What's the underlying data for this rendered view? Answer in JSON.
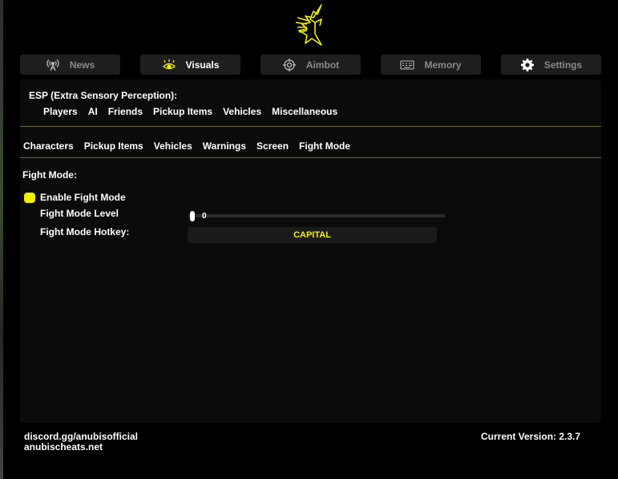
{
  "app": {
    "accent": "#f3f000"
  },
  "tabs": [
    {
      "label": "News",
      "icon": "antenna-icon"
    },
    {
      "label": "Visuals",
      "icon": "eye-icon"
    },
    {
      "label": "Aimbot",
      "icon": "crosshair-icon"
    },
    {
      "label": "Memory",
      "icon": "keyboard-icon"
    },
    {
      "label": "Settings",
      "icon": "gear-icon"
    }
  ],
  "esp": {
    "title": "ESP (Extra Sensory Perception):",
    "categories": [
      "Players",
      "AI",
      "Friends",
      "Pickup Items",
      "Vehicles",
      "Miscellaneous"
    ]
  },
  "subtabs": [
    "Characters",
    "Pickup Items",
    "Vehicles",
    "Warnings",
    "Screen",
    "Fight Mode"
  ],
  "fight_mode": {
    "section_title": "Fight Mode:",
    "enable_label": "Enable Fight Mode",
    "enabled": true,
    "level_label": "Fight Mode Level",
    "level_value": "0",
    "hotkey_label": "Fight Mode Hotkey:",
    "hotkey_value": "CAPITAL"
  },
  "footer": {
    "discord": "discord.gg/anubisofficial",
    "website": "anubischeats.net",
    "version": "Current Version: 2.3.7"
  }
}
